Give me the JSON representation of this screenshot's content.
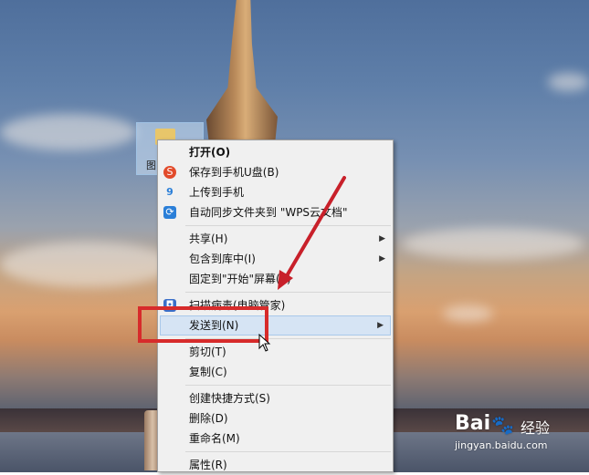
{
  "desktop": {
    "file_label": "图"
  },
  "menu": {
    "items": [
      {
        "label": "打开(O)",
        "bold": true
      },
      {
        "label": "保存到手机U盘(B)",
        "icon": "wps-save-icon"
      },
      {
        "label": "上传到手机",
        "icon": "phone-upload-icon"
      },
      {
        "label": "自动同步文件夹到 \"WPS云文档\"",
        "icon": "cloud-sync-icon"
      },
      {
        "label": "共享(H)",
        "submenu": true
      },
      {
        "label": "包含到库中(I)",
        "submenu": true
      },
      {
        "label": "固定到\"开始\"屏幕(P)"
      },
      {
        "label": "扫描病毒(电脑管家)",
        "icon": "virus-scan-icon"
      },
      {
        "label": "发送到(N)",
        "submenu": true,
        "highlighted": true
      },
      {
        "label": "剪切(T)"
      },
      {
        "label": "复制(C)"
      },
      {
        "label": "创建快捷方式(S)"
      },
      {
        "label": "删除(D)"
      },
      {
        "label": "重命名(M)"
      },
      {
        "label": "属性(R)"
      }
    ]
  },
  "watermark": {
    "brand": "Bai",
    "brand_cn": "经验",
    "url": "jingyan.baidu.com"
  },
  "colors": {
    "highlight_box": "#d72b2b",
    "arrow": "#c8202a",
    "menu_bg": "#f0f0f0"
  }
}
